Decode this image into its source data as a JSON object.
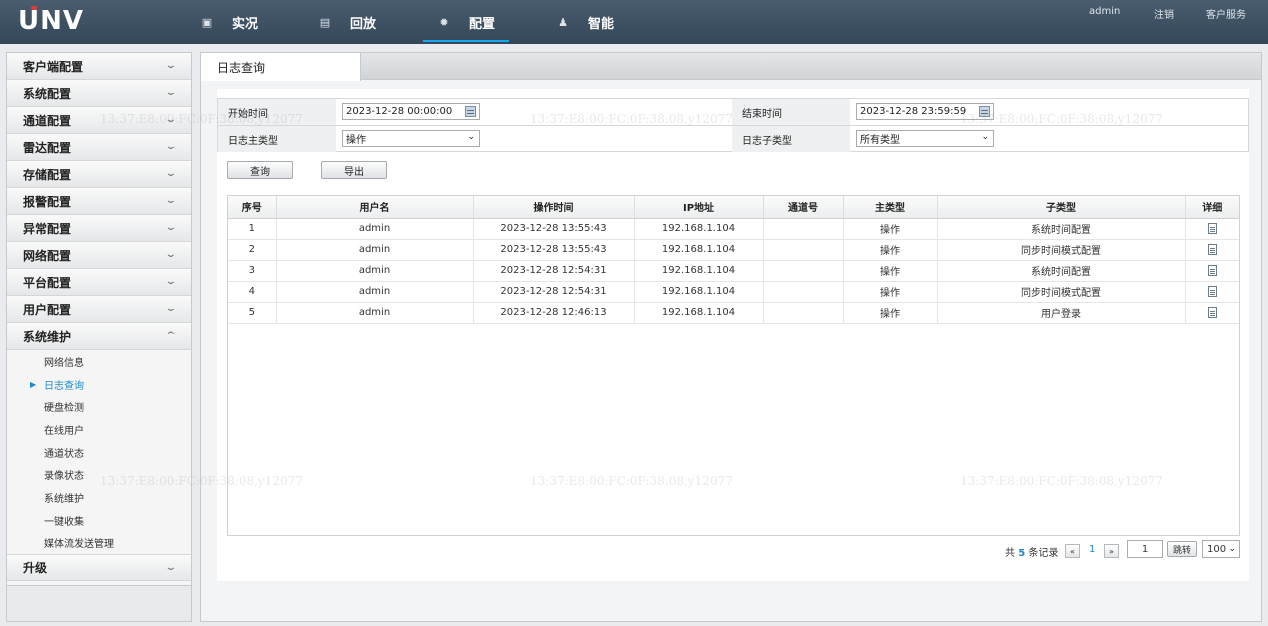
{
  "brand": {
    "logo": "UNV",
    "accent": "#1aa6ee",
    "logo_dot_color": "#e23b3b"
  },
  "nav": {
    "items": [
      {
        "label": "实况",
        "icon": "monitor-icon"
      },
      {
        "label": "回放",
        "icon": "film-icon"
      },
      {
        "label": "配置",
        "icon": "gear-icon",
        "active": true
      },
      {
        "label": "智能",
        "icon": "person-icon"
      }
    ],
    "user": "admin",
    "logout": "注销",
    "service": "客户服务"
  },
  "sidebar": {
    "sections": [
      {
        "label": "客户端配置"
      },
      {
        "label": "系统配置"
      },
      {
        "label": "通道配置"
      },
      {
        "label": "雷达配置"
      },
      {
        "label": "存储配置"
      },
      {
        "label": "报警配置"
      },
      {
        "label": "异常配置"
      },
      {
        "label": "网络配置"
      },
      {
        "label": "平台配置"
      },
      {
        "label": "用户配置"
      },
      {
        "label": "系统维护",
        "expanded": true
      }
    ],
    "sub_items": [
      {
        "label": "网络信息"
      },
      {
        "label": "日志查询",
        "active": true
      },
      {
        "label": "硬盘检测"
      },
      {
        "label": "在线用户"
      },
      {
        "label": "通道状态"
      },
      {
        "label": "录像状态"
      },
      {
        "label": "系统维护"
      },
      {
        "label": "一键收集"
      },
      {
        "label": "媒体流发送管理"
      }
    ],
    "last_section": {
      "label": "升级"
    }
  },
  "page": {
    "tab": "日志查询"
  },
  "filters": {
    "start_label": "开始时间",
    "start_value": "2023-12-28 00:00:00",
    "end_label": "结束时间",
    "end_value": "2023-12-28 23:59:59",
    "main_type_label": "日志主类型",
    "main_type_value": "操作",
    "sub_type_label": "日志子类型",
    "sub_type_value": "所有类型"
  },
  "actions": {
    "query": "查询",
    "export": "导出"
  },
  "table": {
    "headers": [
      "序号",
      "用户名",
      "操作时间",
      "IP地址",
      "通道号",
      "主类型",
      "子类型",
      "详细"
    ],
    "rows": [
      {
        "no": "1",
        "user": "admin",
        "time": "2023-12-28 13:55:43",
        "ip": "192.168.1.104",
        "channel": "",
        "main": "操作",
        "sub": "系统时间配置"
      },
      {
        "no": "2",
        "user": "admin",
        "time": "2023-12-28 13:55:43",
        "ip": "192.168.1.104",
        "channel": "",
        "main": "操作",
        "sub": "同步时间模式配置"
      },
      {
        "no": "3",
        "user": "admin",
        "time": "2023-12-28 12:54:31",
        "ip": "192.168.1.104",
        "channel": "",
        "main": "操作",
        "sub": "系统时间配置"
      },
      {
        "no": "4",
        "user": "admin",
        "time": "2023-12-28 12:54:31",
        "ip": "192.168.1.104",
        "channel": "",
        "main": "操作",
        "sub": "同步时间模式配置"
      },
      {
        "no": "5",
        "user": "admin",
        "time": "2023-12-28 12:46:13",
        "ip": "192.168.1.104",
        "channel": "",
        "main": "操作",
        "sub": "用户登录"
      }
    ]
  },
  "pagination": {
    "total_prefix": "共",
    "total": "5",
    "total_suffix": "条记录",
    "prev": "«",
    "current_page": "1",
    "next": "»",
    "page_input": "1",
    "jump": "跳转",
    "page_size": "100"
  },
  "watermark": "13:37:E8:00:FC:0F:38:08,y12077"
}
